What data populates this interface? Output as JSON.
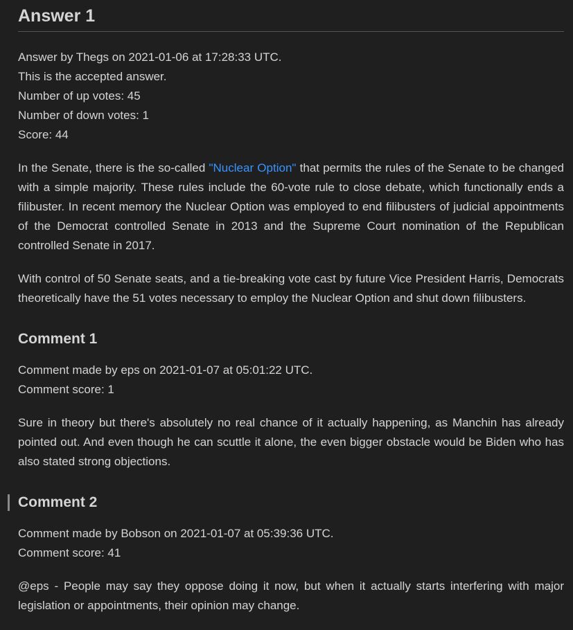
{
  "answer": {
    "heading": "Answer 1",
    "meta": [
      "Answer by Thegs on 2021-01-06 at 17:28:33 UTC.",
      "This is the accepted answer.",
      "Number of up votes: 45",
      "Number of down votes: 1",
      "Score: 44"
    ],
    "p1_before": "In the Senate, there is the so-called ",
    "p1_link": "\"Nuclear Option\"",
    "p1_after": " that permits the rules of the Senate to be changed with a simple majority. These rules include the 60-vote rule to close debate, which functionally ends a filibuster. In recent memory the Nuclear Option was employed to end filibusters of judicial appointments of the Democrat controlled Senate in 2013 and the Supreme Court nomination of the Republican controlled Senate in 2017.",
    "p2": "With control of 50 Senate seats, and a tie-breaking vote cast by future Vice President Harris, Democrats theoretically have the 51 votes necessary to employ the Nuclear Option and shut down filibusters."
  },
  "comments": [
    {
      "heading": "Comment 1",
      "meta": [
        "Comment made by eps on 2021-01-07 at 05:01:22 UTC.",
        "Comment score: 1"
      ],
      "body": "Sure in theory but there's absolutely no real chance of it actually happening, as Manchin has already pointed out. And even though he can scuttle it alone, the even bigger obstacle would be Biden who has also stated strong objections."
    },
    {
      "heading": "Comment 2",
      "meta": [
        "Comment made by Bobson on 2021-01-07 at 05:39:36 UTC.",
        "Comment score: 41"
      ],
      "body": "@eps - People may say they oppose doing it now, but when it actually starts interfering with major legislation or appointments, their opinion may change."
    }
  ]
}
